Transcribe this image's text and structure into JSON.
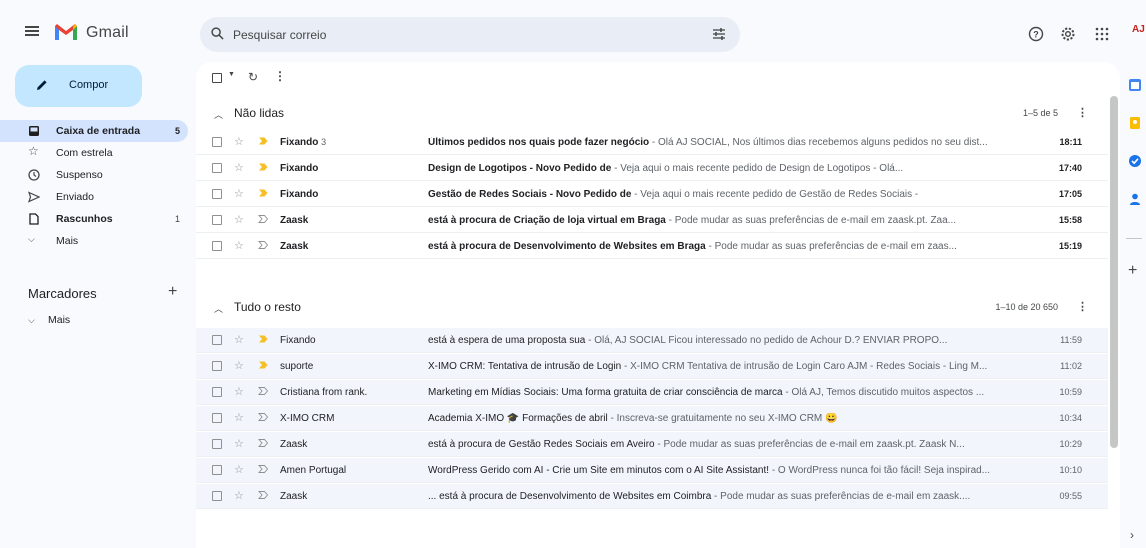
{
  "app": {
    "name": "Gmail"
  },
  "search": {
    "placeholder": "Pesquisar correio"
  },
  "account": {
    "initials": "AJ"
  },
  "compose": {
    "label": "Compor"
  },
  "nav": {
    "items": [
      {
        "label": "Caixa de entrada",
        "count": "5",
        "icon": "inbox-icon"
      },
      {
        "label": "Com estrela",
        "count": "",
        "icon": "star-icon"
      },
      {
        "label": "Suspenso",
        "count": "",
        "icon": "clock-icon"
      },
      {
        "label": "Enviado",
        "count": "",
        "icon": "send-icon"
      },
      {
        "label": "Rascunhos",
        "count": "1",
        "icon": "draft-icon"
      },
      {
        "label": "Mais",
        "count": "",
        "icon": "chevron-down-icon"
      }
    ]
  },
  "labels": {
    "title": "Marcadores",
    "more": "Mais"
  },
  "sections": {
    "unread": {
      "title": "Não lidas",
      "range": "1–5 de 5",
      "rows": [
        {
          "sender": "Fixando",
          "count": "3",
          "subject": "Últimos pedidos nos quais pode fazer negócio",
          "snippet": " - Olá AJ SOCIAL, Nos últimos dias recebemos alguns pedidos no seu dist...",
          "time": "18:11",
          "important": true
        },
        {
          "sender": "Fixando",
          "count": "",
          "subject": "Design de Logotipos - Novo Pedido de",
          "snippet": " - Veja aqui o mais recente pedido de Design de Logotipos - Olá...",
          "time": "17:40",
          "important": true
        },
        {
          "sender": "Fixando",
          "count": "",
          "subject": "Gestão de Redes Sociais - Novo Pedido de",
          "snippet": " - Veja aqui o mais recente pedido de Gestão de Redes Sociais -",
          "time": "17:05",
          "important": true
        },
        {
          "sender": "Zaask",
          "count": "",
          "subject": "está à procura de Criação de loja virtual em Braga",
          "snippet": " - Pode mudar as suas preferências de e-mail em zaask.pt. Zaa...",
          "time": "15:58",
          "important": false
        },
        {
          "sender": "Zaask",
          "count": "",
          "subject": "está à procura de Desenvolvimento de Websites em Braga",
          "snippet": " - Pode mudar as suas preferências de e-mail em zaas...",
          "time": "15:19",
          "important": false
        }
      ]
    },
    "rest": {
      "title": "Tudo o resto",
      "range": "1–10 de 20 650",
      "rows": [
        {
          "sender": "Fixando",
          "subject": "está à espera de uma proposta sua",
          "snippet": " - Olá, AJ SOCIAL Ficou interessado no pedido de Achour D.? ENVIAR PROPO...",
          "time": "11:59",
          "important": true
        },
        {
          "sender": "suporte",
          "subject": "X-IMO CRM: Tentativa de intrusão de Login",
          "snippet": " - X-IMO CRM Tentativa de intrusão de Login Caro AJM - Redes Sociais - Ling M...",
          "time": "11:02",
          "important": true
        },
        {
          "sender": "Cristiana from rank.",
          "subject": "Marketing em Mídias Sociais: Uma forma gratuita de criar consciência de marca",
          "snippet": " - Olá AJ, Temos discutido muitos aspectos ...",
          "time": "10:59",
          "important": false
        },
        {
          "sender": "X-IMO CRM",
          "subject": "Academia X-IMO 🎓 Formações de abril",
          "snippet": " - Inscreva-se gratuitamente no seu X-IMO CRM 😀",
          "time": "10:34",
          "important": false
        },
        {
          "sender": "Zaask",
          "subject": "está à procura de Gestão Redes Sociais em Aveiro",
          "snippet": " - Pode mudar as suas preferências de e-mail em zaask.pt. Zaask N...",
          "time": "10:29",
          "important": false
        },
        {
          "sender": "Amen Portugal",
          "subject": "WordPress Gerido com AI - Crie um Site em minutos com o AI Site Assistant!",
          "snippet": " - O WordPress nunca foi tão fácil! Seja inspirad...",
          "time": "10:10",
          "important": false
        },
        {
          "sender": "Zaask",
          "subject": "... está à procura de Desenvolvimento de Websites em Coimbra",
          "snippet": " - Pode mudar as suas preferências de e-mail em zaask....",
          "time": "09:55",
          "important": false
        }
      ]
    }
  },
  "colors": {
    "accent": "#c2e7ff",
    "selected_nav": "#d3e3fd",
    "important_marker": "#f6bf26",
    "gmail_red": "#ea4335"
  }
}
